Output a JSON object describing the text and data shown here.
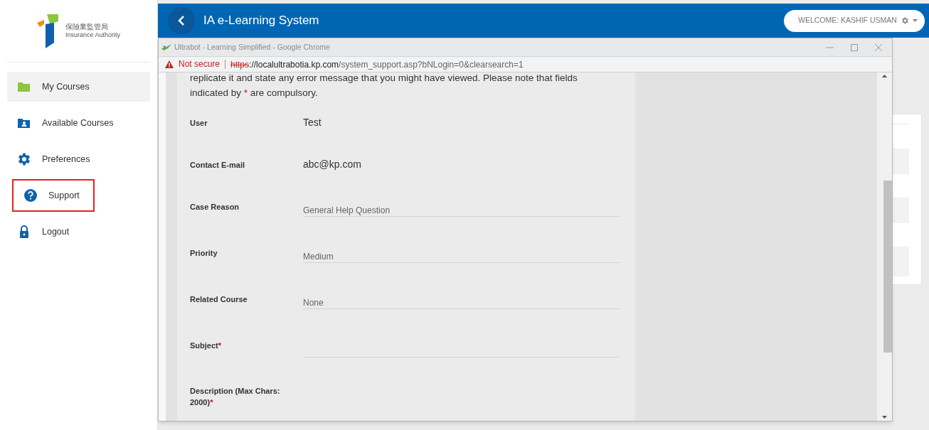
{
  "sidebar": {
    "logo": {
      "chinese": "保險業監管局",
      "english": "Insurance Authority"
    },
    "items": [
      {
        "label": "My Courses",
        "kind": "folder",
        "selected": true,
        "highlighted": false
      },
      {
        "label": "Available Courses",
        "kind": "user-folder",
        "selected": false,
        "highlighted": false
      },
      {
        "label": "Preferences",
        "kind": "gear",
        "selected": false,
        "highlighted": false
      },
      {
        "label": "Support",
        "kind": "help",
        "selected": false,
        "highlighted": true
      },
      {
        "label": "Logout",
        "kind": "lock",
        "selected": false,
        "highlighted": false
      }
    ]
  },
  "header": {
    "title": "IA e-Learning System",
    "welcome": "WELCOME: KASHIF USMAN"
  },
  "popup": {
    "window_title": "Ultrabot - Learning Simplified - Google Chrome",
    "security": "Not secure",
    "url": {
      "scheme": "https",
      "host": "://localultrabotia.kp.com",
      "path": "/system_support.asp?bNLogin=0&clearsearch=1"
    },
    "intro": {
      "before": "replicate it and state any error message that you might have viewed. Please note that fields indicated by",
      "mark": "*",
      "after": "are compulsory."
    },
    "fields": [
      {
        "label": "User",
        "kind": "text",
        "value": "Test"
      },
      {
        "label": "Contact E-mail",
        "kind": "text",
        "value": "abc@kp.com"
      },
      {
        "label": "Case Reason",
        "kind": "select",
        "value": "General Help Question"
      },
      {
        "label": "Priority",
        "kind": "select",
        "value": "Medium"
      },
      {
        "label": "Related Course",
        "kind": "select",
        "value": "None"
      },
      {
        "label": "Subject",
        "mark": "*",
        "kind": "input"
      },
      {
        "label": "Description (Max Chars: 2000)",
        "mark": "*",
        "kind": "textarea"
      }
    ]
  }
}
